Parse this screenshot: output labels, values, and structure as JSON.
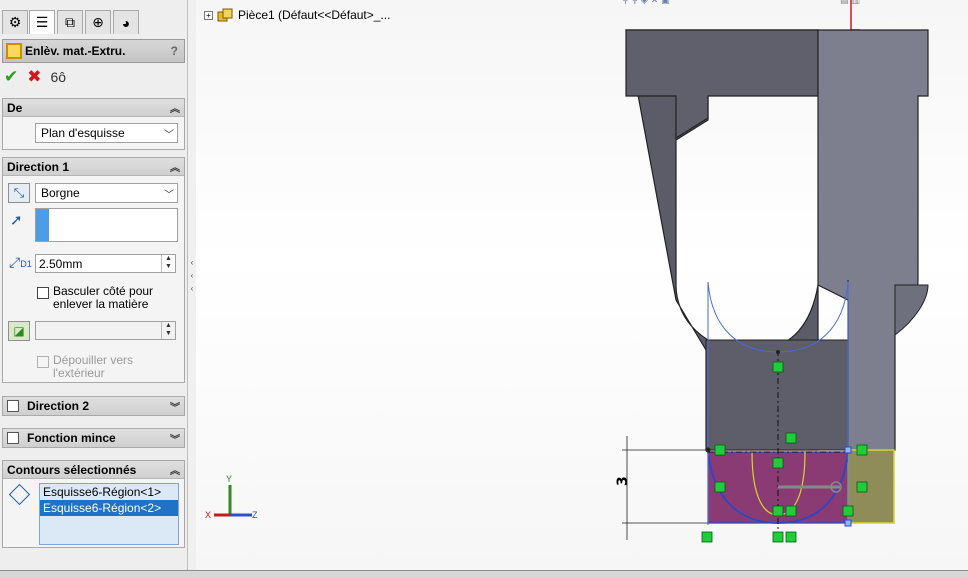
{
  "tabs": [
    {
      "icon": "feature-manager-icon",
      "active": false
    },
    {
      "icon": "property-manager-icon",
      "active": true
    },
    {
      "icon": "configuration-manager-icon",
      "active": false
    },
    {
      "icon": "dimxpert-icon",
      "active": false
    },
    {
      "icon": "display-manager-icon",
      "active": false
    }
  ],
  "property_manager": {
    "title": "Enlèv. mat.-Extru.",
    "help": "?"
  },
  "groups": {
    "from": {
      "title": "De",
      "start_condition": "Plan d'esquisse"
    },
    "direction1": {
      "title": "Direction 1",
      "end_condition": "Borgne",
      "depth": "2.50mm",
      "depth_icon_label": "D1",
      "flip_side_label": "Basculer côté pour enlever la matière",
      "draft_label": "Dépouiller vers l'extérieur"
    },
    "direction2": {
      "title": "Direction 2"
    },
    "thin_feature": {
      "title": "Fonction mince"
    },
    "selected_contours": {
      "title": "Contours sélectionnés",
      "items": [
        "Esquisse6-Région<1>",
        "Esquisse6-Région<2>"
      ]
    }
  },
  "tree": {
    "node_label": "Pièce1  (Défaut<<Défaut>_..."
  },
  "dimension": {
    "value": "3"
  },
  "triad": {
    "x": "X",
    "y": "Y",
    "z": "Z"
  },
  "colors": {
    "accent": "#1f72c6",
    "ok": "#2b9a1e",
    "cancel": "#d2161b",
    "model_dark": "#5a5b66",
    "model_light": "#7e8090",
    "relation_green": "#1fcc3a",
    "sketch_blue": "#2c46c8",
    "region_magenta": "#8a3b73",
    "region_yellow": "#8c8a58"
  }
}
